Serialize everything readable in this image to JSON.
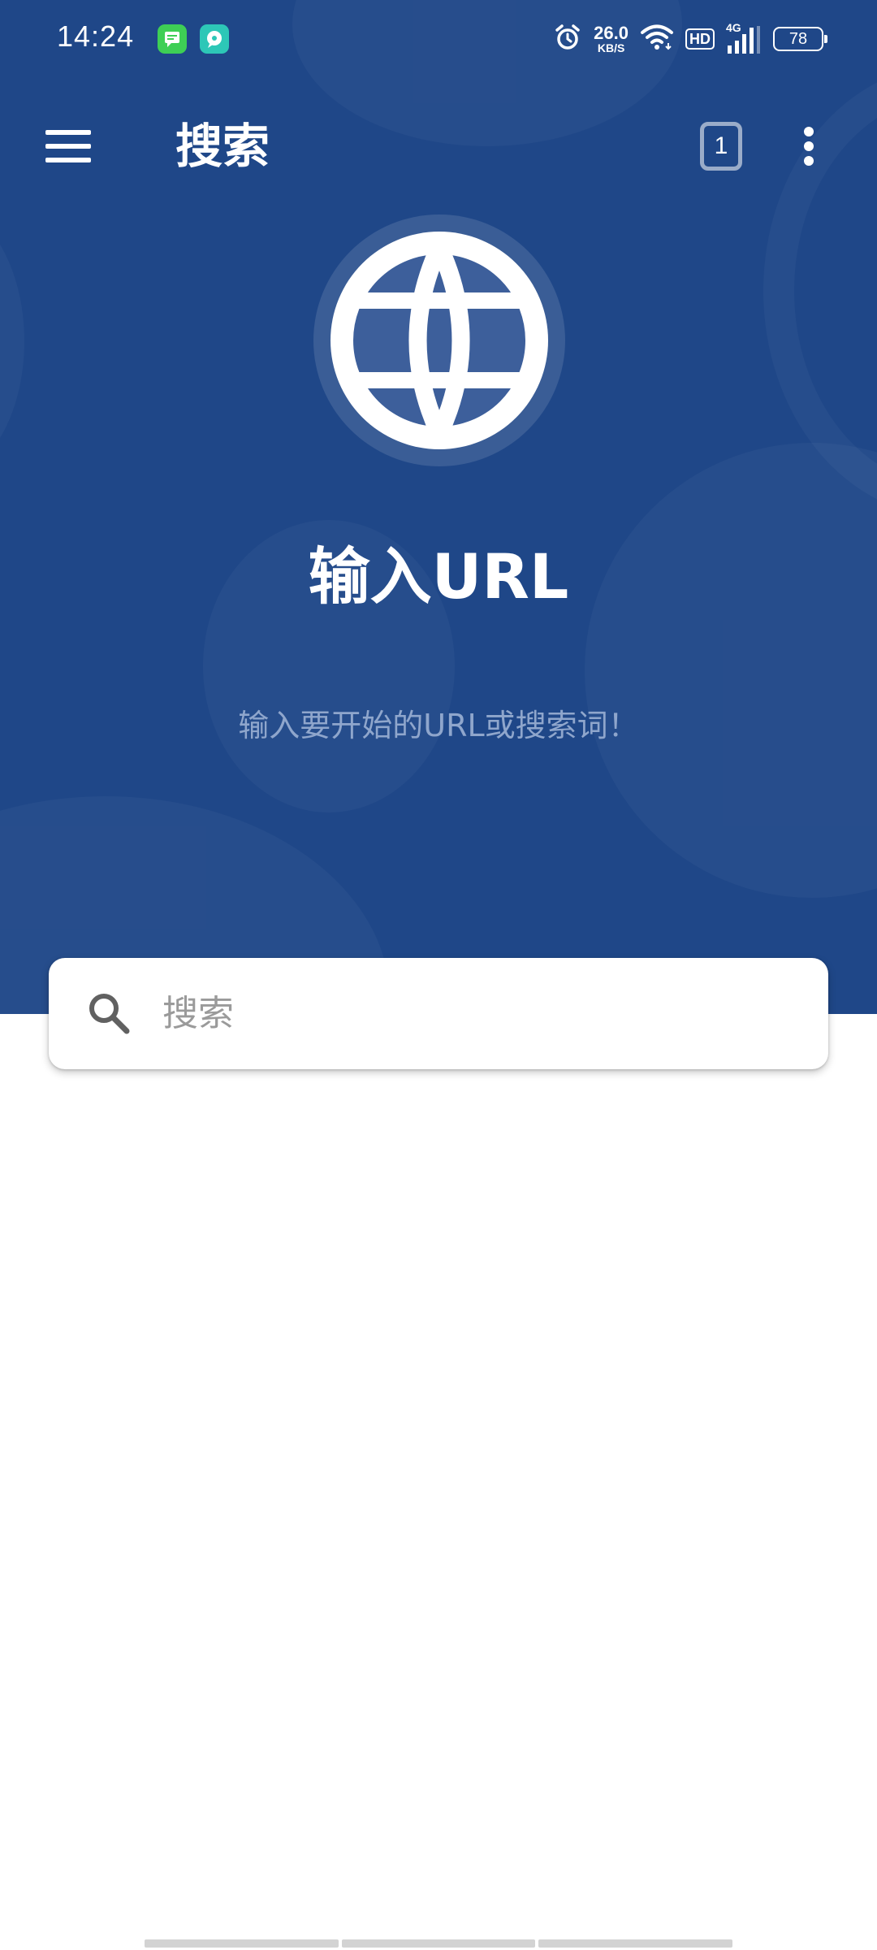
{
  "status_bar": {
    "time": "14:24",
    "net_speed_value": "26.0",
    "net_speed_unit": "KB/S",
    "hd_label": "HD",
    "network_type": "4G",
    "battery_level": "78",
    "app_icons": [
      {
        "name": "messages-app-icon",
        "color": "#3ecf55"
      },
      {
        "name": "chat-app-icon",
        "color": "#2dc7b7"
      }
    ]
  },
  "app_bar": {
    "title": "搜索",
    "tab_count": "1",
    "menu_icon": "hamburger-menu-icon",
    "overflow_icon": "more-vert-icon"
  },
  "hero": {
    "icon": "globe-icon",
    "heading": "输入URL",
    "subtitle": "输入要开始的URL或搜索词！"
  },
  "search": {
    "icon": "search-icon",
    "placeholder": "搜索",
    "value": ""
  },
  "colors": {
    "primary": "#1f4788",
    "globe_fill": "#3d5f9b",
    "subtitle_text": "#8fa6cc",
    "surface": "#ffffff"
  }
}
